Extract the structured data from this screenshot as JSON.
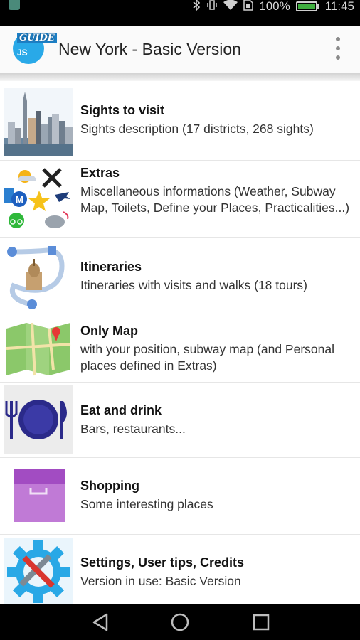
{
  "status_bar": {
    "battery_percent": "100%",
    "time": "11:45",
    "icons": [
      "bluetooth-icon",
      "vibrate-icon",
      "wifi-icon",
      "sim-icon",
      "battery-icon"
    ]
  },
  "app_bar": {
    "logo_line1": "GUIDE",
    "logo_line2": "JS",
    "title": "New York - Basic Version",
    "menu_icon": "overflow-menu-icon"
  },
  "menu_items": [
    {
      "title": "Sights to visit",
      "description": "Sights description (17 districts, 268 sights)",
      "icon": "skyline-icon"
    },
    {
      "title": "Extras",
      "description": "Miscellaneous informations (Weather, Subway Map, Toilets, Define your Places, Practicalities...)",
      "icon": "extras-collage-icon"
    },
    {
      "title": "Itineraries",
      "description": "Itineraries with visits and walks (18 tours)",
      "icon": "itinerary-route-icon"
    },
    {
      "title": "Only Map",
      "description": "with your position, subway map (and Personal places defined in Extras)",
      "icon": "map-icon"
    },
    {
      "title": "Eat and drink",
      "description": "Bars, restaurants...",
      "icon": "plate-cutlery-icon"
    },
    {
      "title": "Shopping",
      "description": "Some interesting places",
      "icon": "shopping-box-icon"
    },
    {
      "title": "Settings, User tips, Credits",
      "description": "Version in use: Basic Version",
      "icon": "settings-gear-tools-icon"
    }
  ],
  "nav_bar": {
    "buttons": [
      "back-icon",
      "home-icon",
      "recents-icon"
    ]
  }
}
